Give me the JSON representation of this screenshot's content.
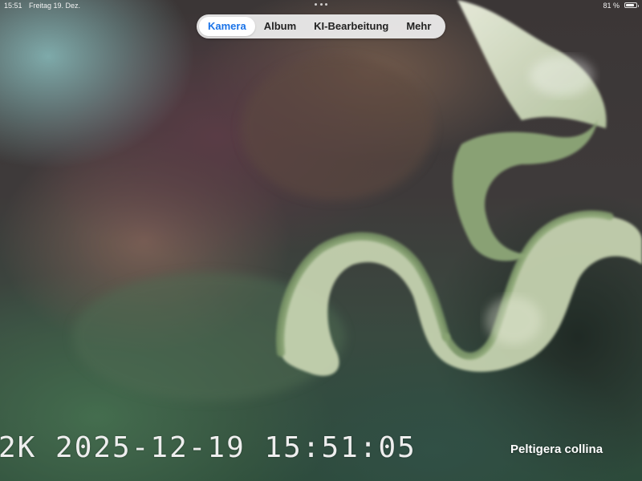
{
  "status_bar": {
    "time": "15:51",
    "date": "Freitag 19. Dez.",
    "battery_percent_label": "81 %",
    "battery_level": 0.81
  },
  "tabs": [
    {
      "label": "Kamera",
      "active": true
    },
    {
      "label": "Album",
      "active": false
    },
    {
      "label": "KI-Bearbeitung",
      "active": false
    },
    {
      "label": "Mehr",
      "active": false
    }
  ],
  "camera_view": {
    "timestamp_overlay": "2K 2025-12-19 15:51:05",
    "species_label": "Peltigera collina"
  },
  "colors": {
    "active_tab": "#1a73e8",
    "lichen_green": "#8fa77a",
    "lichen_pale": "#e6ecd6"
  }
}
